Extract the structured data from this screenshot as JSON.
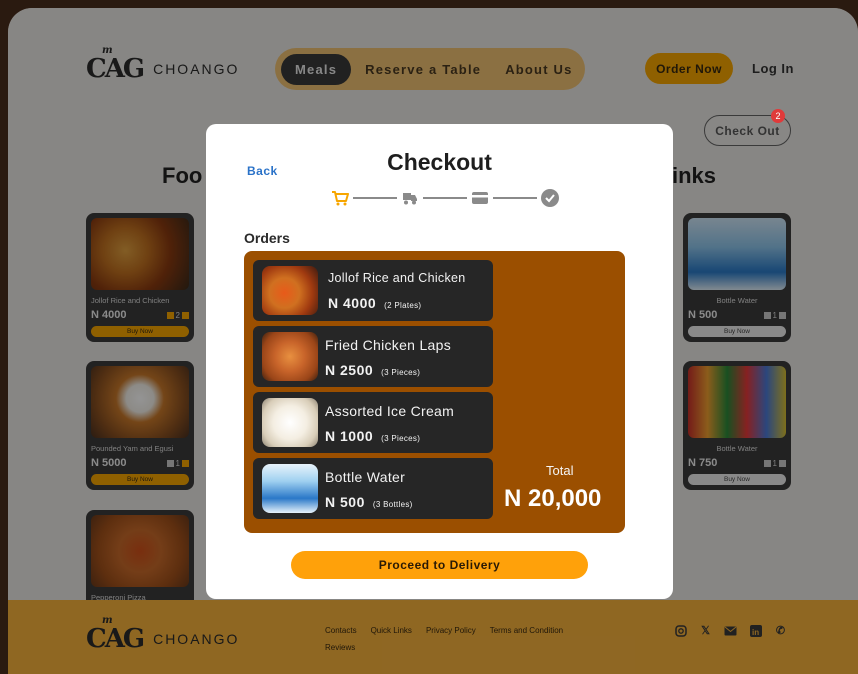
{
  "brand": {
    "name": "CHOANGO",
    "logo_text": "CAG",
    "logo_small": "m"
  },
  "nav": {
    "items": [
      {
        "label": "Meals",
        "active": true
      },
      {
        "label": "Reserve a Table"
      },
      {
        "label": "About Us"
      }
    ]
  },
  "header": {
    "order_now": "Order Now",
    "login": "Log In",
    "checkout": "Check Out",
    "cart_count": "2"
  },
  "sections": {
    "food_title": "Foo",
    "drinks_title": "inks"
  },
  "food_cards": [
    {
      "name": "Jollof Rice and Chicken",
      "price": "N 4000",
      "qty": "2",
      "buy": "Buy Now"
    },
    {
      "name": "Pounded Yam and Egusi",
      "price": "N 5000",
      "qty": "1",
      "buy": "Buy Now"
    },
    {
      "name": "Pepperoni Pizza"
    }
  ],
  "drink_cards": [
    {
      "name": "Bottle Water",
      "price": "N 500",
      "qty": "1",
      "buy": "Buy Now"
    },
    {
      "name": "Bottle Water",
      "price": "N 750",
      "qty": "1",
      "buy": "Buy Now"
    }
  ],
  "footer": {
    "links": [
      "Contacts",
      "Quick Links",
      "Privacy Policy",
      "Terms and Condition"
    ],
    "links2": "Reviews",
    "socials": [
      "instagram-icon",
      "x-icon",
      "mail-icon",
      "linkedin-icon",
      "phone-icon"
    ]
  },
  "modal": {
    "back": "Back",
    "title": "Checkout",
    "steps": [
      "cart-icon",
      "delivery-icon",
      "card-icon",
      "check-icon"
    ],
    "orders_label": "Orders",
    "orders": [
      {
        "name": "Jollof Rice and Chicken",
        "price": "N 4000",
        "qty": "(2 Plates)"
      },
      {
        "name": "Fried Chicken Laps",
        "price": "N 2500",
        "qty": "(3 Pieces)"
      },
      {
        "name": "Assorted Ice Cream",
        "price": "N 1000",
        "qty": "(3 Pieces)"
      },
      {
        "name": "Bottle Water",
        "price": "N 500",
        "qty": "(3 Bottles)"
      }
    ],
    "total_label": "Total",
    "total_value": "N 20,000",
    "proceed": "Proceed to Delivery"
  },
  "colors": {
    "accent": "#ffa10a",
    "panel": "#9b4f00",
    "item_bg": "#262626",
    "link": "#2a72c8"
  }
}
